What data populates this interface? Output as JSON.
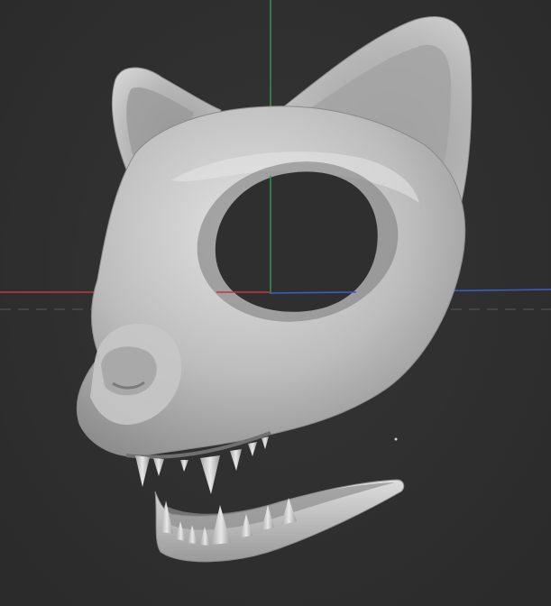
{
  "viewport": {
    "background_color": "#2e2e2e",
    "grid_line_color": "#4a4a4a",
    "axis_x_color": "#c0383a",
    "axis_y_color": "#3c8f4e",
    "axis_z_color": "#3a5fc8",
    "model_color": "#c8c8c8",
    "model_shadow_color": "#7a7a7a",
    "model_name_icon": "cat-skull-mask-sculpt"
  }
}
